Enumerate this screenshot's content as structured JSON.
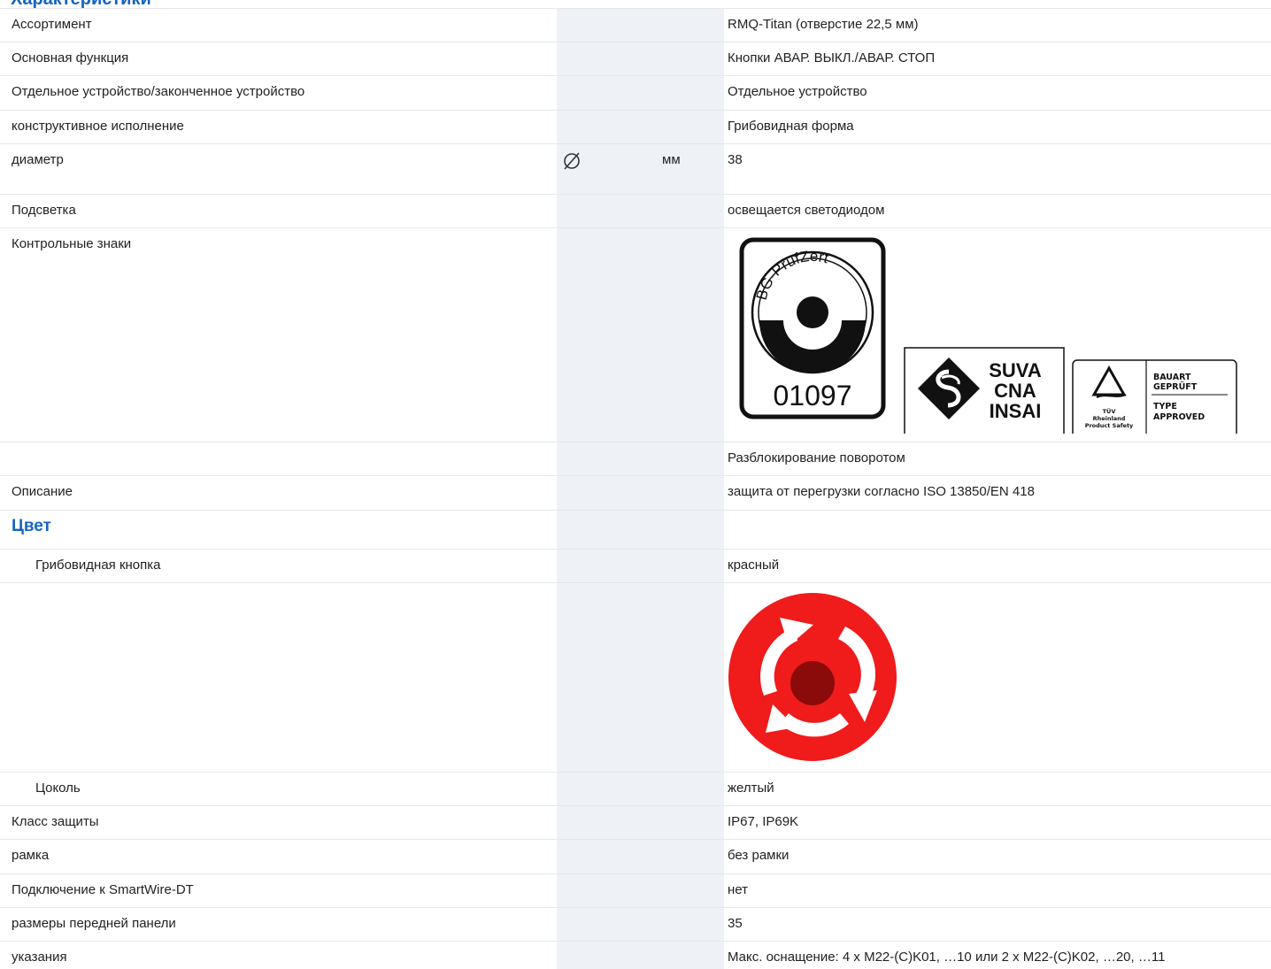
{
  "header": {
    "cut_heading": "Характеристики"
  },
  "rows": {
    "assortment": {
      "label": "Ассортимент",
      "value": "RMQ-Titan (отверстие 22,5 мм)"
    },
    "main_function": {
      "label": "Основная функция",
      "value": "Кнопки АВАР. ВЫКЛ./АВАР. СТОП"
    },
    "device_type": {
      "label": "Отдельное устройство/законченное устройство",
      "value": "Отдельное устройство"
    },
    "design": {
      "label": "конструктивное исполнение",
      "value": "Грибовидная форма"
    },
    "diameter": {
      "label": "диаметр",
      "symbol": "⌀",
      "unit": "мм",
      "value": "38"
    },
    "lighting": {
      "label": "Подсветка",
      "value": "освещается светодиодом"
    },
    "approvals": {
      "label": "Контрольные знаки",
      "bg_text": "BG-PrüfZert",
      "bg_number": "01097",
      "suva_lines": [
        "SUVA",
        "CNA",
        "INSAI"
      ],
      "tuv_left": [
        "TÜV",
        "Rheinland",
        "Product Safety"
      ],
      "tuv_right_top": [
        "BAUART",
        "GEPRÜFT"
      ],
      "tuv_right_bottom": [
        "TYPE",
        "APPROVED"
      ]
    },
    "unlock": {
      "label": "",
      "value": "Разблокирование поворотом"
    },
    "description": {
      "label": "Описание",
      "value": "защита от перегрузки согласно ISO 13850/EN 418"
    },
    "color_section": {
      "title": "Цвет"
    },
    "mushroom_button": {
      "label": "Грибовидная кнопка",
      "value": "красный"
    },
    "base": {
      "label": "Цоколь",
      "value": "желтый"
    },
    "protection": {
      "label": "Класс защиты",
      "value": "IP67, IP69K"
    },
    "frame": {
      "label": "рамка",
      "value": "без рамки"
    },
    "smartwire": {
      "label": "Подключение к SmartWire-DT",
      "value": "нет"
    },
    "front_dims": {
      "label": "размеры передней панели",
      "value": "35"
    },
    "notes": {
      "label": "указания",
      "value": "Макс. оснащение: 4 x M22-(C)K01, …10 или 2 x M22-(C)K02, …20, …11"
    }
  },
  "colors": {
    "heading_blue": "#1565c0",
    "button_red": "#f01b1b",
    "button_center": "#8b0a0a",
    "gray_column": "#eef1f5"
  }
}
